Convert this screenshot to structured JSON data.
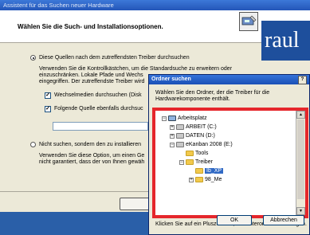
{
  "wizard": {
    "title": "Assistent für das Suchen neuer Hardware",
    "heading": "Wählen Sie die Such- und Installationsoptionen.",
    "option1_label": "Diese Quellen nach dem zutreffendsten Treiber durchsuchen",
    "option1_desc_1": "Verwenden Sie die Kontrollkästchen, um die Standardsuche zu erweitern oder",
    "option1_desc_2": "einzuschränken. Lokale Pfade und Wechs",
    "option1_desc_3": "eingegriffen. Der zutreffendste Treiber wird",
    "check1_label": "Wechselmedien durchsuchen (Disk",
    "check2_label": "Folgende Quelle ebenfalls durchsuc",
    "option2_label": "Nicht suchen, sondern den zu installieren",
    "option2_desc_1": "Verwenden Sie diese Option, um einen Ge",
    "option2_desc_2": "nicht garantiert, dass der von Ihnen gewäh",
    "brand_text": "raul"
  },
  "dialog": {
    "title": "Ordner suchen",
    "help_label": "?",
    "close_label": "×",
    "desc_1": "Wählen Sie den Ordner, der die Treiber für die",
    "desc_2": "Hardwarekomponente enthält.",
    "tree": {
      "arbeitsplatz": "Arbeitsplatz",
      "arbeit": "ARBEIT (C:)",
      "daten": "DATEN (D:)",
      "ekanban": "eKanban 2008 (E:)",
      "tools": "Tools",
      "treiber": "Treiber",
      "xp": "Ib_XP",
      "me": "98_Me"
    },
    "hint": "Klicken Sie auf ein Pluszeichen, um Unterordner anzuzeigen.",
    "ok_label": "OK",
    "cancel_label": "Abbrechen"
  },
  "colors": {
    "highlight": "#e5262b",
    "selection": "#316ac5",
    "titlebar": "#2456b8"
  }
}
